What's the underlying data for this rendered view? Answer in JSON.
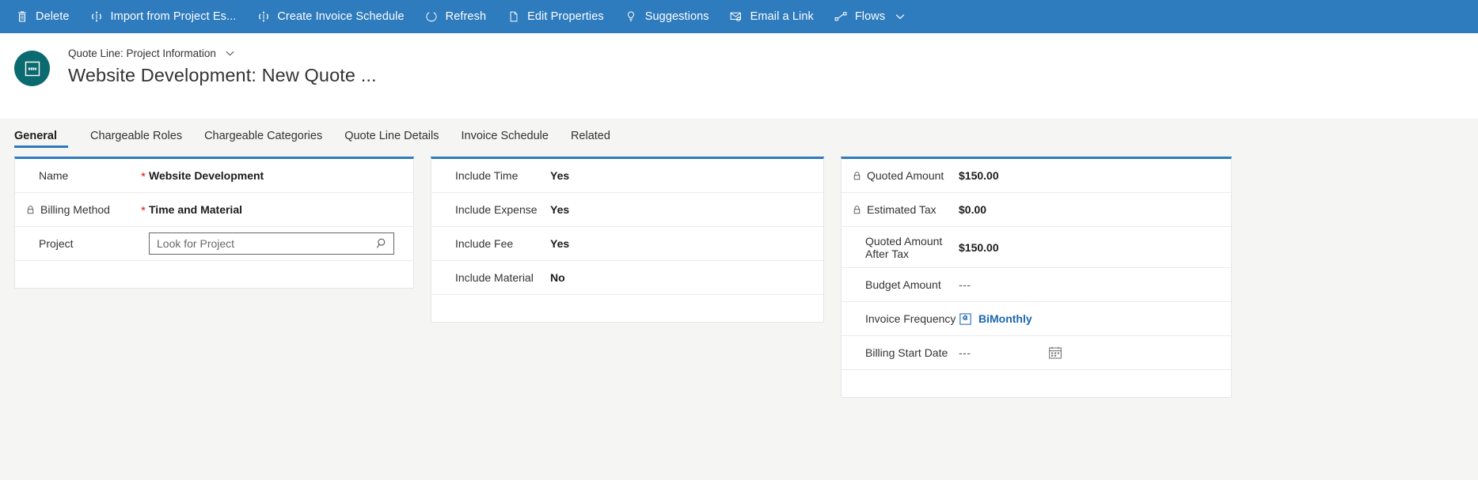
{
  "commandbar": {
    "items": [
      {
        "label": "Delete",
        "icon": "trash-icon"
      },
      {
        "label": "Import from Project Es...",
        "icon": "import-icon"
      },
      {
        "label": "Create Invoice Schedule",
        "icon": "invoice-schedule-icon"
      },
      {
        "label": "Refresh",
        "icon": "refresh-icon"
      },
      {
        "label": "Edit Properties",
        "icon": "edit-properties-icon"
      },
      {
        "label": "Suggestions",
        "icon": "lightbulb-icon"
      },
      {
        "label": "Email a Link",
        "icon": "email-link-icon"
      },
      {
        "label": "Flows",
        "icon": "flows-icon",
        "chevron": true
      }
    ],
    "background": "#2e7bbd"
  },
  "record": {
    "breadcrumb": "Quote Line: Project Information",
    "title": "Website Development: New Quote ...",
    "avatar_icon": "quote-line-entity-icon",
    "avatar_color": "#0b6a6f"
  },
  "tabs": [
    {
      "label": "General",
      "active": true
    },
    {
      "label": "Chargeable Roles",
      "active": false
    },
    {
      "label": "Chargeable Categories",
      "active": false
    },
    {
      "label": "Quote Line Details",
      "active": false
    },
    {
      "label": "Invoice Schedule",
      "active": false
    },
    {
      "label": "Related",
      "active": false
    }
  ],
  "accent_color": "#2e7bbd",
  "required_color": "#e31b0c",
  "link_color": "#1a66b3",
  "cards": {
    "general": {
      "name": {
        "label": "Name",
        "value": "Website Development",
        "required": "*"
      },
      "billing_method": {
        "label": "Billing Method",
        "value": "Time and Material",
        "required": "*",
        "icon": "lock-icon"
      },
      "project": {
        "label": "Project",
        "value": "",
        "placeholder": "Look for Project",
        "icon": "search-icon"
      }
    },
    "includes": {
      "include_time": {
        "label": "Include Time",
        "value": "Yes"
      },
      "include_expense": {
        "label": "Include Expense",
        "value": "Yes"
      },
      "include_fee": {
        "label": "Include Fee",
        "value": "Yes"
      },
      "include_material": {
        "label": "Include Material",
        "value": "No"
      }
    },
    "amounts": {
      "quoted_amount": {
        "label": "Quoted Amount",
        "value": "$150.00",
        "icon": "lock-icon"
      },
      "estimated_tax": {
        "label": "Estimated Tax",
        "value": "$0.00",
        "icon": "lock-icon"
      },
      "quoted_amount_after_tax": {
        "label": "Quoted Amount After Tax",
        "value": "$150.00"
      },
      "budget_amount": {
        "label": "Budget Amount",
        "value": "---"
      },
      "invoice_frequency": {
        "label": "Invoice Frequency",
        "value": "BiMonthly",
        "icon": "puzzle-icon"
      },
      "billing_start_date": {
        "label": "Billing Start Date",
        "value": "---",
        "icon": "calendar-icon"
      }
    }
  }
}
